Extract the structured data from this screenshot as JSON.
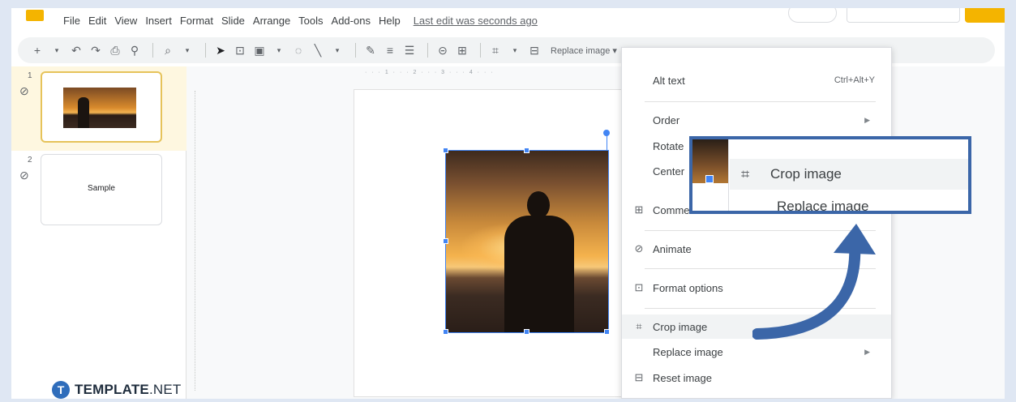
{
  "menubar": {
    "items": [
      "File",
      "Edit",
      "View",
      "Insert",
      "Format",
      "Slide",
      "Arrange",
      "Tools",
      "Add-ons",
      "Help"
    ],
    "last_edit": "Last edit was seconds ago"
  },
  "toolbar": {
    "icons": [
      "add-icon",
      "dropdown-icon",
      "undo-icon",
      "redo-icon",
      "print-icon",
      "paint-format-icon",
      "zoom-icon",
      "dropdown-icon",
      "select-icon",
      "textbox-icon",
      "image-icon",
      "shape-icon",
      "line-icon",
      "dropdown-icon",
      "pen-icon",
      "border-weight-icon",
      "border-dash-icon",
      "link-icon",
      "comment-icon",
      "crop-icon",
      "dropdown-icon",
      "replace-image-icon"
    ],
    "replace_image_label": "Replace image ▾"
  },
  "filmstrip": {
    "slides": [
      {
        "number": "1",
        "label": ""
      },
      {
        "number": "2",
        "label": "Sample"
      }
    ]
  },
  "ruler": {
    "top_marks": "· · · 1 · · · 2 · · · 3 · · · 4 · · ·"
  },
  "context_menu": {
    "alt_text": "Alt text",
    "alt_text_shortcut": "Ctrl+Alt+Y",
    "order": "Order",
    "rotate": "Rotate",
    "center": "Center",
    "comment": "Comme",
    "animate": "Animate",
    "format_options": "Format options",
    "crop_image": "Crop image",
    "replace_image": "Replace image",
    "reset_image": "Reset image"
  },
  "callout": {
    "crop_image": "Crop image",
    "replace_image": "Replace image"
  },
  "logo": {
    "mark": "T",
    "bold": "TEMPLATE",
    "thin": ".NET"
  },
  "colors": {
    "accent_blue": "#4285f4",
    "callout_border": "#3b66a8",
    "arrow_blue": "#3b66a8",
    "active_slide": "#fef7e0"
  }
}
